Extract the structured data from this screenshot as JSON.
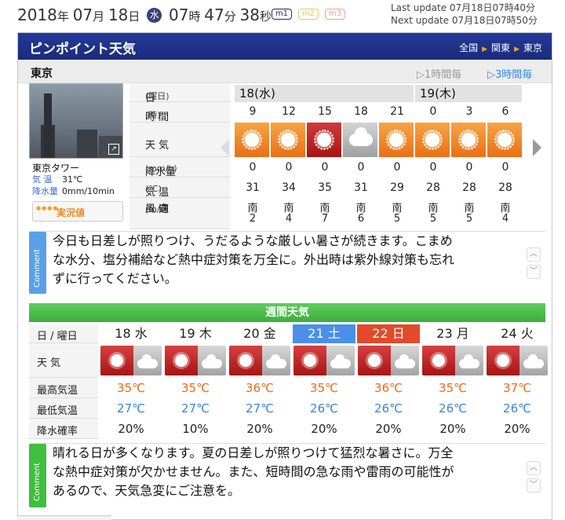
{
  "clock": {
    "year": "2018",
    "year_unit": "年",
    "month": "07",
    "month_unit": "月",
    "day": "18",
    "day_unit": "日",
    "dow": "水",
    "hour": "07",
    "hour_unit": "時",
    "minute": "47",
    "minute_unit": "分",
    "second": "38",
    "second_unit": "秒"
  },
  "map_buttons": [
    "m1",
    "m2",
    "m3"
  ],
  "updates": {
    "last": "Last update  07月18日07時40分",
    "next": "Next update  07月18日07時50分"
  },
  "header": {
    "title": "ピンポイント天気",
    "crumbs": [
      "全国",
      "関東",
      "東京"
    ]
  },
  "location": {
    "name": "東京",
    "step1": "1時間毎",
    "step3": "3時間毎"
  },
  "camera": {
    "name": "東京タワー",
    "temp_label": "気 温",
    "temp_value": "31℃",
    "rain_label": "降水量",
    "rain_value": "0mm/10min",
    "jikkyo_label": "実況値"
  },
  "hourly": {
    "labels": {
      "date": "日",
      "date_unit": "(曜日)",
      "time": "時 間",
      "time_unit": "(時)",
      "weather": "天 気",
      "precip": "降水量",
      "precip_unit": "(mm/h)",
      "temp": "気 温",
      "temp_unit": "(℃)",
      "wind_dir": "風 向",
      "wind_speed": "風 速",
      "wind_unit": "(m/s)"
    },
    "dates": [
      "18(水)",
      "19(木)"
    ],
    "hours": [
      "9",
      "12",
      "15",
      "18",
      "21",
      "0",
      "3",
      "6"
    ],
    "weather_icons": [
      "sunny",
      "sunny",
      "hot-sunny",
      "cloudy",
      "sunny",
      "sunny",
      "sunny",
      "sunny"
    ],
    "precip": [
      "0",
      "0",
      "0",
      "0",
      "0",
      "0",
      "0",
      "0"
    ],
    "temp": [
      "31",
      "34",
      "35",
      "31",
      "29",
      "28",
      "28",
      "28"
    ],
    "wind_dir": [
      "南",
      "南",
      "南",
      "南",
      "南",
      "南",
      "南",
      "南"
    ],
    "wind_speed": [
      "2",
      "4",
      "7",
      "6",
      "5",
      "5",
      "5",
      "4"
    ]
  },
  "comment1": {
    "tab": "Comment",
    "line1": "今日も日差しが照りつけ、うだるような厳しい暑さが続きます。こまめ",
    "line2": "な水分、塩分補給など熱中症対策を万全に。外出時は紫外線対策も忘れ",
    "line3": "ずに行ってください。"
  },
  "weekly": {
    "title": "週間天気",
    "labels": {
      "day": "日 / 曜日",
      "weather": "天 気",
      "hi": "最高気温",
      "lo": "最低気温",
      "pop": "降水確率"
    },
    "days": [
      "18 水",
      "19 木",
      "20 金",
      "21 土",
      "22 日",
      "23 月",
      "24 火"
    ],
    "icons": [
      "hot-sunny-cloudy",
      "hot-sunny-cloudy",
      "hot-sunny-cloudy",
      "hot-sunny-cloudy",
      "hot-sunny-cloudy",
      "hot-sunny-cloudy",
      "hot-sunny-cloudy"
    ],
    "hi": [
      "35℃",
      "35℃",
      "36℃",
      "35℃",
      "36℃",
      "35℃",
      "37℃"
    ],
    "lo": [
      "27℃",
      "27℃",
      "27℃",
      "26℃",
      "26℃",
      "26℃",
      "26℃"
    ],
    "pop": [
      "20%",
      "10%",
      "20%",
      "20%",
      "20%",
      "20%",
      "20%"
    ]
  },
  "comment2": {
    "tab": "Comment",
    "line1": "晴れる日が多くなります。夏の日差しが照りつけて猛烈な暑さに。万全",
    "line2": "な熱中症対策が欠かせません。また、短時間の急な雨や雷雨の可能性が",
    "line3": "あるので、天気急変にご注意を。"
  },
  "colors": {
    "header": "#1a2b7a",
    "sunny": "#ea6f14",
    "hot": "#a71414",
    "saturday": "#4b8fe8",
    "sunday": "#e24a2a",
    "weekly_header": "#3cae3c"
  }
}
